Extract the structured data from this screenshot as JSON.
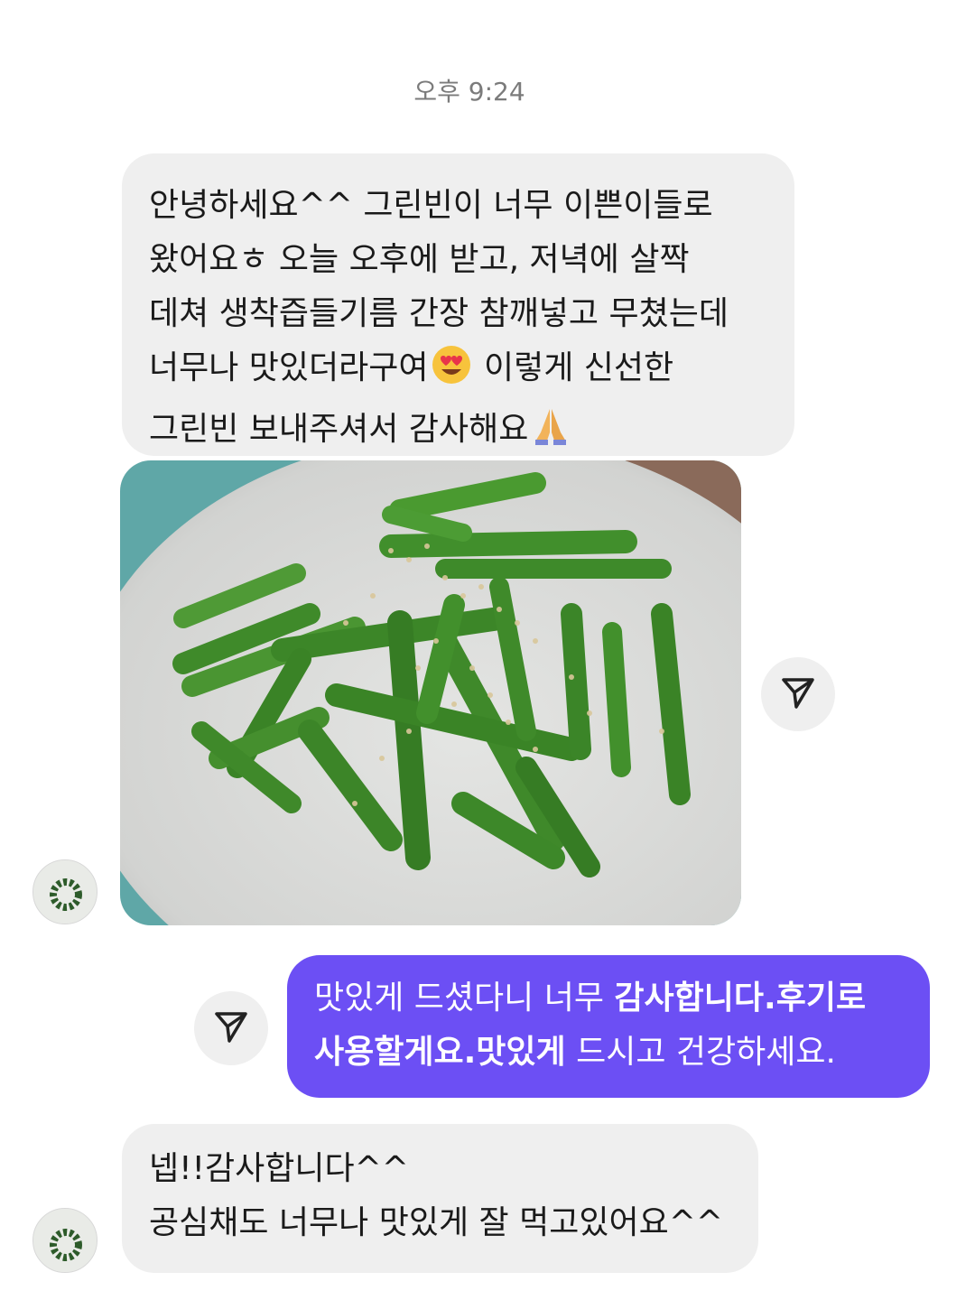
{
  "timestamp": "오후 9:24",
  "messages": {
    "incoming_1": {
      "lines": [
        "안녕하세요^^  그린빈이 너무 이쁜이들로",
        "왔어요ㅎ 오늘 오후에 받고, 저녁에 살짝",
        "데쳐 생착즙들기름 간장 참깨넣고 무쳤는데",
        "너무나 맛있더라구여",
        " 이렇게 신선한",
        "그린빈 보내주셔서 감사해요"
      ],
      "emojis": [
        "heart-eyes-emoji",
        "folded-hands-emoji"
      ]
    },
    "photo": {
      "description_icon": "green-beans-photo"
    },
    "outgoing_1": {
      "line1_normal": "맛있게 드셨다니 너무 ",
      "line1_bold": "감사합니다.후기로",
      "line2_bold": "사용할게요.맛있게",
      "line2_normal": " 드시고 건강하세요."
    },
    "incoming_2": {
      "lines": [
        "넵!!감사합니다^^",
        "공심채도 너무나 맛있게 잘 먹고있어요^^"
      ]
    }
  },
  "icons": {
    "share": "send-arrow-icon",
    "avatar": "profile-avatar-icon"
  },
  "colors": {
    "incoming_bubble": "#efefef",
    "outgoing_bubble": "#6c4ff4",
    "timestamp_text": "#7b7b7b"
  }
}
